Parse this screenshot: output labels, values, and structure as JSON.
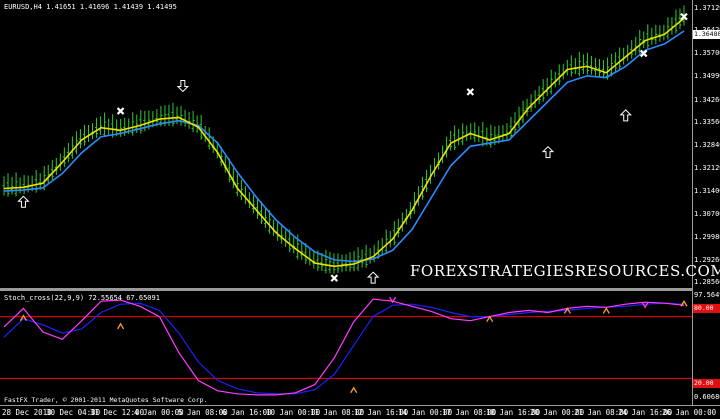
{
  "chart_title": "EURUSD,H4  1.41651 1.41696 1.41439 1.41495",
  "indicator_title": "Stoch_cross(22,9,9) 72.55654 67.65091",
  "watermark": "FOREXSTRATEGIESRESOURCES.COM",
  "copyright": "FastFX Trader, © 2001-2011 MetaQuotes Software Corp.",
  "price_scale": [
    "1.37120",
    "1.36420",
    "1.35700",
    "1.34990",
    "1.34260",
    "1.33560",
    "1.32840",
    "1.32120",
    "1.31400",
    "1.30700",
    "1.29980",
    "1.29260",
    "1.28560"
  ],
  "current_price_tag": "1.36480",
  "indicator_scale": [
    "97.5649",
    "80.00",
    "20.00",
    "0.60680"
  ],
  "indicator_tag_top": "80.00",
  "indicator_tag_bottom": "20.00",
  "time_labels": [
    "28 Dec 2010",
    "30 Dec 04:00",
    "31 Dec 12:00",
    "4 Jan 00:00",
    "5 Jan 08:00",
    "6 Jan 16:00",
    "10 Jan 00:00",
    "11 Jan 08:00",
    "12 Jan 16:00",
    "14 Jan 00:00",
    "17 Jan 08:00",
    "18 Jan 16:00",
    "20 Jan 00:00",
    "21 Jan 08:00",
    "24 Jan 16:00",
    "26 Jan 00:00"
  ],
  "colors": {
    "candle": "#2ecc2e",
    "ma_fast": "#f0e000",
    "ma_slow": "#2a8cff",
    "stoch_main": "#ff3cff",
    "stoch_signal": "#2020ff",
    "level_line": "#ff0000",
    "markers": "#ffffff"
  },
  "chart_data": {
    "type": "line",
    "symbol": "EURUSD",
    "timeframe": "H4",
    "ylim": [
      1.2856,
      1.3712
    ],
    "series": [
      {
        "values": [
          1.3148,
          1.3152,
          1.3165,
          1.323,
          1.33,
          1.3338,
          1.333,
          1.3345,
          1.3365,
          1.337,
          1.334,
          1.326,
          1.315,
          1.308,
          1.301,
          1.296,
          1.2915,
          1.2905,
          1.2912,
          1.2935,
          1.299,
          1.308,
          1.319,
          1.329,
          1.332,
          1.33,
          1.332,
          1.34,
          1.346,
          1.352,
          1.353,
          1.351,
          1.356,
          1.361,
          1.363,
          1.368
        ]
      },
      {
        "values": [
          1.314,
          1.3143,
          1.315,
          1.3195,
          1.326,
          1.331,
          1.332,
          1.3335,
          1.335,
          1.336,
          1.3345,
          1.329,
          1.32,
          1.312,
          1.305,
          1.2995,
          1.295,
          1.2925,
          1.292,
          1.2928,
          1.2955,
          1.302,
          1.312,
          1.322,
          1.328,
          1.329,
          1.33,
          1.336,
          1.342,
          1.348,
          1.35,
          1.3495,
          1.353,
          1.358,
          1.36,
          1.364
        ]
      }
    ],
    "stoch_main": [
      70,
      88,
      65,
      58,
      76,
      95,
      96,
      90,
      80,
      45,
      18,
      8,
      5,
      4,
      4,
      6,
      14,
      40,
      75,
      97,
      95,
      90,
      85,
      78,
      76,
      80,
      84,
      86,
      84,
      88,
      90,
      89,
      92,
      94,
      93,
      91
    ],
    "stoch_signal": [
      60,
      78,
      72,
      64,
      68,
      84,
      92,
      93,
      86,
      64,
      36,
      18,
      10,
      6,
      5,
      5,
      9,
      24,
      52,
      80,
      91,
      92,
      89,
      84,
      80,
      80,
      82,
      84,
      85,
      86,
      88,
      89,
      90,
      92,
      93,
      92
    ],
    "levels": [
      80,
      20
    ]
  }
}
